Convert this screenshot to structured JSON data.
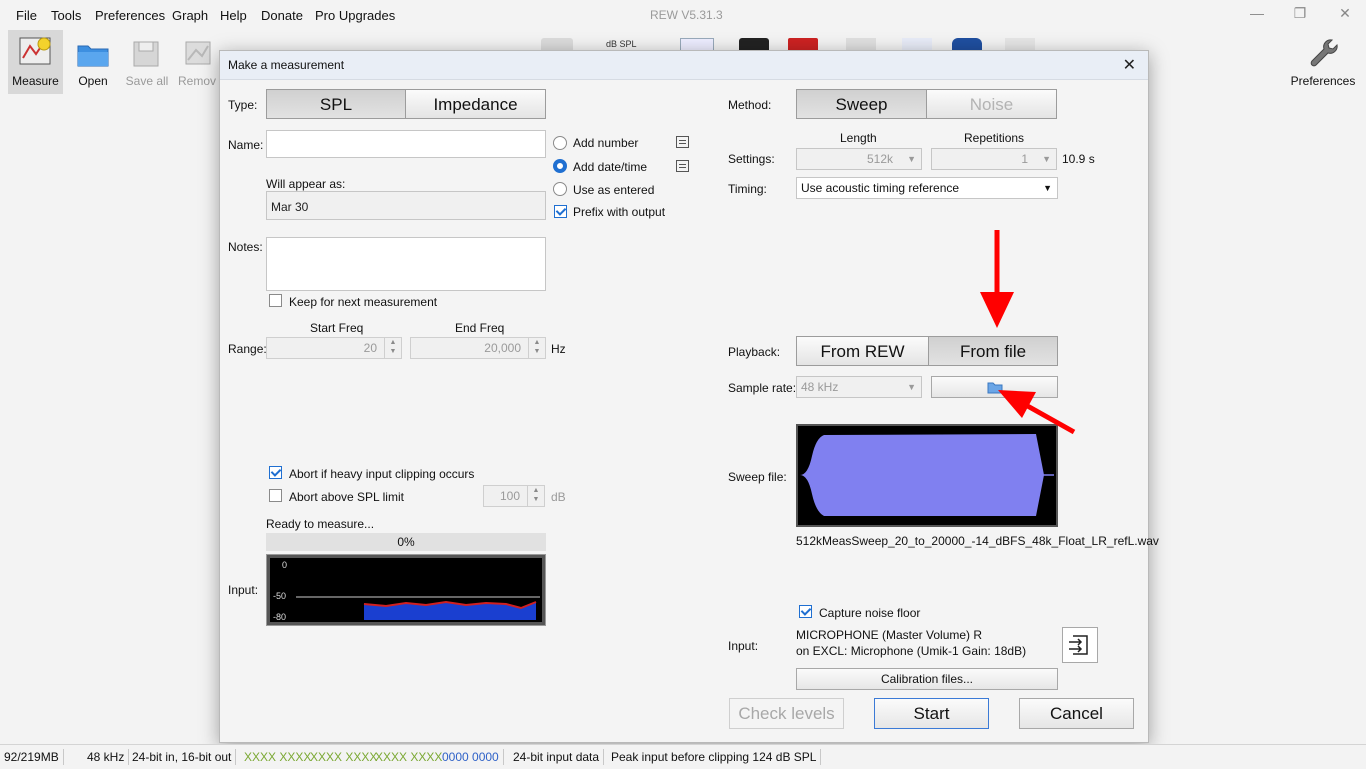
{
  "menu": [
    "File",
    "Tools",
    "Preferences",
    "Graph",
    "Help",
    "Donate",
    "Pro Upgrades"
  ],
  "app_title": "REW V5.31.3",
  "toolbar": {
    "measure": "Measure",
    "open": "Open",
    "save_all": "Save all",
    "remove": "Remov",
    "preferences": "Preferences",
    "spl_icon_text": "dB SPL"
  },
  "dialog": {
    "title": "Make a measurement",
    "type_label": "Type:",
    "type_options": [
      "SPL",
      "Impedance"
    ],
    "type_selected": "SPL",
    "name_label": "Name:",
    "name_value": "",
    "name_options": [
      "Add number",
      "Add date/time",
      "Use as entered"
    ],
    "name_option_selected": "Add date/time",
    "prefix_with_output": "Prefix with output",
    "will_appear_label": "Will appear as:",
    "will_appear_value": "Mar 30",
    "notes_label": "Notes:",
    "keep_for_next": "Keep for next measurement",
    "range_label": "Range:",
    "start_freq_label": "Start Freq",
    "end_freq_label": "End Freq",
    "start_freq": "20",
    "end_freq": "20,000",
    "freq_unit": "Hz",
    "abort_clipping": "Abort if heavy input clipping occurs",
    "abort_spl": "Abort above SPL limit",
    "spl_limit": "100",
    "spl_unit": "dB",
    "status": "Ready to measure...",
    "progress_text": "0%",
    "progress": 0,
    "input_label": "Input:",
    "meter_ticks": [
      "0",
      "-50",
      "-80"
    ],
    "method_label": "Method:",
    "method_options": [
      "Sweep",
      "Noise"
    ],
    "method_selected": "Sweep",
    "settings_label": "Settings:",
    "length_label": "Length",
    "repetitions_label": "Repetitions",
    "length_value": "512k",
    "repetitions_value": "1",
    "duration": "10.9 s",
    "timing_label": "Timing:",
    "timing_value": "Use acoustic timing reference",
    "playback_label": "Playback:",
    "playback_options": [
      "From REW",
      "From file"
    ],
    "playback_selected": "From file",
    "sample_rate_label": "Sample rate:",
    "sample_rate_value": "48 kHz",
    "sweep_file_label": "Sweep file:",
    "sweep_filename": "512kMeasSweep_20_to_20000_-14_dBFS_48k_Float_LR_refL.wav",
    "capture_noise_floor": "Capture noise floor",
    "right_input_label": "Input:",
    "input_device_line1": "MICROPHONE (Master Volume) R",
    "input_device_line2": "on EXCL: Microphone (Umik-1  Gain: 18dB)",
    "calibration_button": "Calibration files...",
    "check_levels_button": "Check levels",
    "start_button": "Start",
    "cancel_button": "Cancel"
  },
  "statusbar": {
    "memory": "92/219MB",
    "rate": "48 kHz",
    "bits": "24-bit in, 16-bit out",
    "indicators_green": [
      "XXXX XXXX",
      "XXXX XXXX",
      "XXXX XXXX"
    ],
    "indicator_blue": "0000 0000",
    "input_data": "24-bit input data",
    "peak": "Peak input before clipping 124 dB SPL"
  },
  "colors": {
    "accent": "#1f6fd1",
    "sweep_waveform": "#8080f0",
    "annotation_arrow": "#ff0000",
    "status_green": "#7aa832",
    "status_blue": "#2f62c8"
  }
}
